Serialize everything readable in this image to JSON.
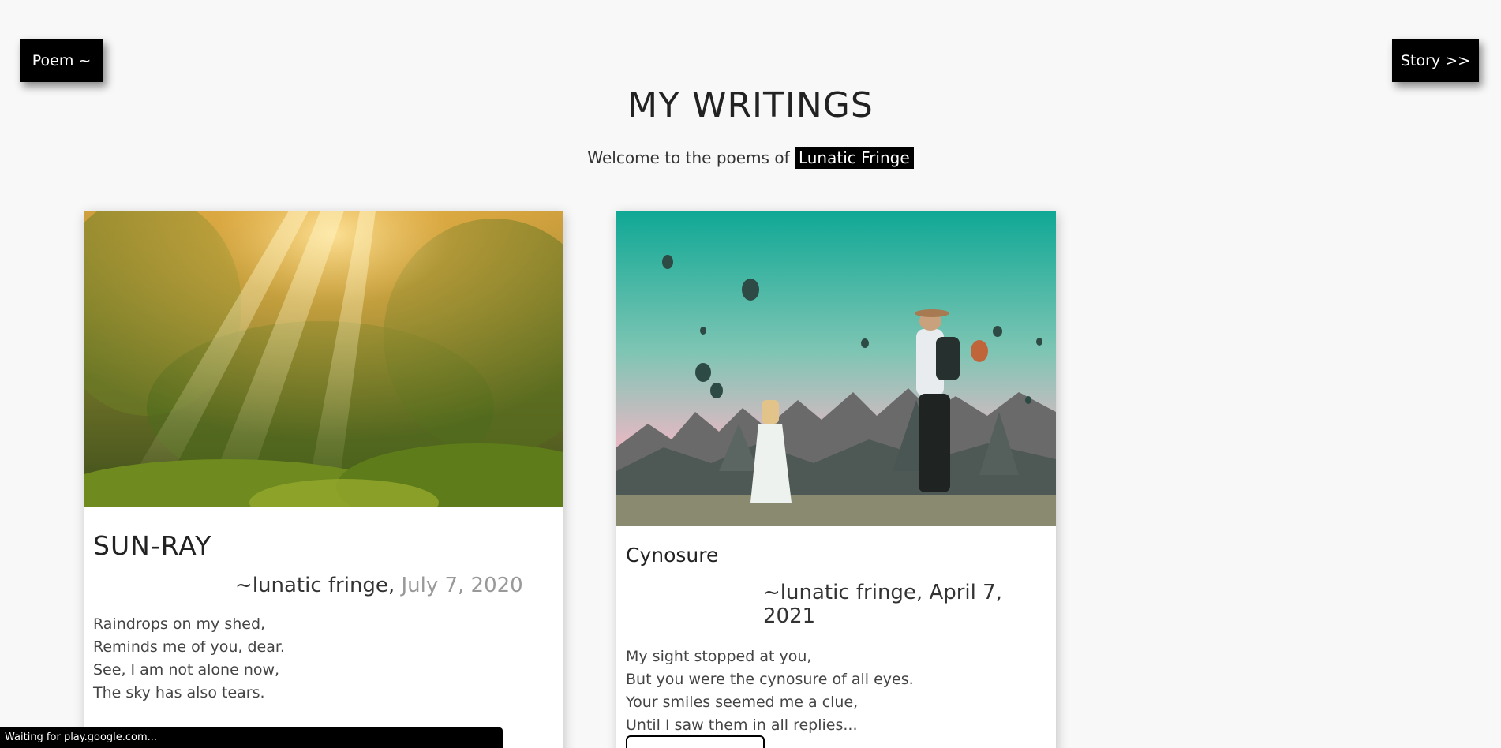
{
  "nav": {
    "left_label": "Poem ~",
    "right_label": "Story >>"
  },
  "header": {
    "title": "MY WRITINGS",
    "subtitle_prefix": "Welcome to the poems of",
    "subtitle_highlight": "Lunatic Fringe"
  },
  "cards": [
    {
      "title": "SUN-RAY",
      "author": "~lunatic fringe,",
      "date": "July 7, 2020",
      "image": "forest-sunlight-photo",
      "lines": [
        "Raindrops on my shed,",
        "Reminds me of you, dear.",
        "See, I am not alone now,",
        "The sky has also tears."
      ]
    },
    {
      "title": "Cynosure",
      "author": "~lunatic fringe,",
      "date": "April 7, 2021",
      "image": "hot-air-balloons-couple-photo",
      "lines": [
        "My sight stopped at you,",
        "But you were the cynosure of all eyes.",
        "Your smiles seemed me a clue,",
        "Until I saw them in all replies..."
      ]
    }
  ],
  "status": {
    "text": "Waiting for play.google.com..."
  }
}
